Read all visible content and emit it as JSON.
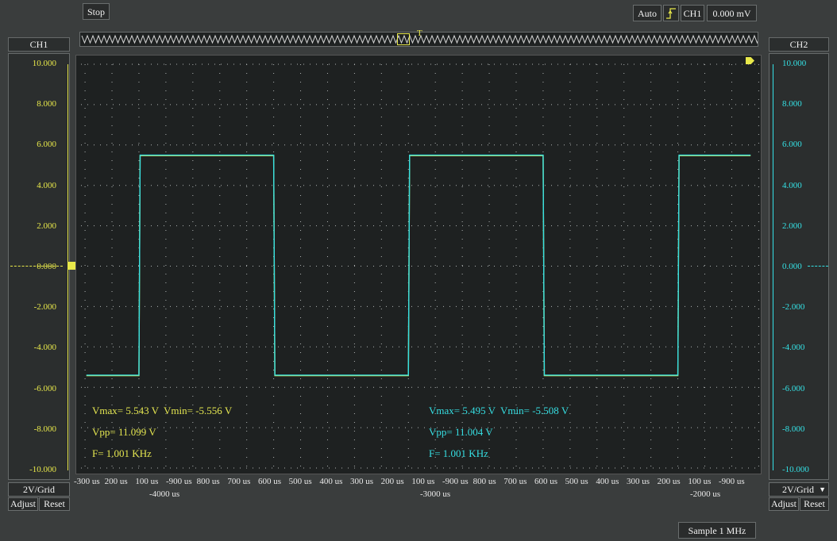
{
  "toolbar": {
    "stop_label": "Stop",
    "trigger_mode": "Auto",
    "trigger_channel": "CH1",
    "trigger_level": "0.000 mV"
  },
  "ch1": {
    "title": "CH1",
    "color": "#e8e84a",
    "ticks": [
      "10.000",
      "8.000",
      "6.000",
      "4.000",
      "2.000",
      "0.000",
      "-2.000",
      "-4.000",
      "-6.000",
      "-8.000",
      "-10.000"
    ],
    "scale": "2V/Grid",
    "adjust_label": "Adjust",
    "reset_label": "Reset"
  },
  "ch2": {
    "title": "CH2",
    "color": "#34e0e4",
    "ticks": [
      "10.000",
      "8.000",
      "6.000",
      "4.000",
      "2.000",
      "0.000",
      "-2.000",
      "-4.000",
      "-6.000",
      "-8.000",
      "-10.000"
    ],
    "scale": "2V/Grid",
    "adjust_label": "Adjust",
    "reset_label": "Reset"
  },
  "measurements": {
    "ch1": {
      "vmax_vmin": "Vmax= 5.543 V  Vmin= -5.556 V",
      "vpp": "Vpp= 11.099 V",
      "freq": "F= 1.001 KHz"
    },
    "ch2": {
      "vmax_vmin": "Vmax= 5.495 V  Vmin= -5.508 V",
      "vpp": "Vpp= 11.004 V",
      "freq": "F= 1.001 KHz"
    }
  },
  "x_axis": {
    "row1": [
      "-300 us",
      "200 us",
      "100 us",
      "-900 us",
      "800 us",
      "700 us",
      "600 us",
      "500 us",
      "400 us",
      "300 us",
      "200 us",
      "100 us",
      "-900 us",
      "800 us",
      "700 us",
      "600 us",
      "500 us",
      "400 us",
      "300 us",
      "200 us",
      "100 us",
      "-900 us"
    ],
    "row2": [
      "-4000 us",
      "-3000 us",
      "-2000 us"
    ]
  },
  "sample_rate": "Sample 1 MHz",
  "chart_data": {
    "type": "line",
    "ylim": [
      -10,
      10
    ],
    "series": [
      {
        "name": "CH1",
        "levels": [
          -5.4,
          5.5
        ],
        "edges_us": [
          -4100,
          -3600,
          -3100,
          -2600,
          -2100
        ]
      },
      {
        "name": "CH2",
        "levels": [
          -5.4,
          5.5
        ],
        "edges_us": [
          -4100,
          -3600,
          -3100,
          -2600,
          -2100
        ]
      }
    ]
  }
}
